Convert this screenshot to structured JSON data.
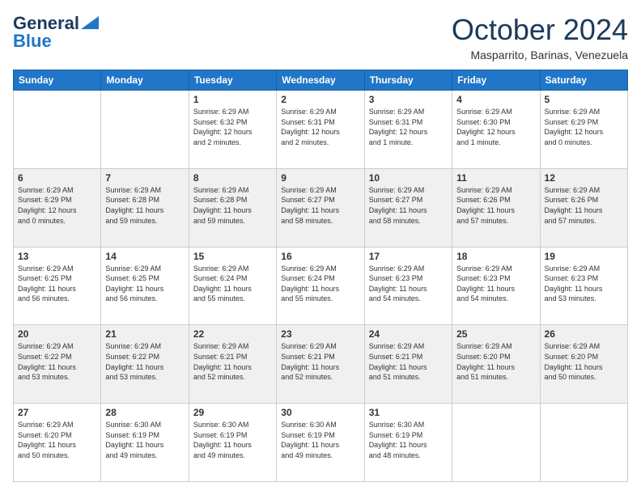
{
  "header": {
    "logo_line1": "General",
    "logo_line2": "Blue",
    "month": "October 2024",
    "location": "Masparrito, Barinas, Venezuela"
  },
  "weekdays": [
    "Sunday",
    "Monday",
    "Tuesday",
    "Wednesday",
    "Thursday",
    "Friday",
    "Saturday"
  ],
  "weeks": [
    [
      {
        "day": "",
        "info": ""
      },
      {
        "day": "",
        "info": ""
      },
      {
        "day": "1",
        "info": "Sunrise: 6:29 AM\nSunset: 6:32 PM\nDaylight: 12 hours\nand 2 minutes."
      },
      {
        "day": "2",
        "info": "Sunrise: 6:29 AM\nSunset: 6:31 PM\nDaylight: 12 hours\nand 2 minutes."
      },
      {
        "day": "3",
        "info": "Sunrise: 6:29 AM\nSunset: 6:31 PM\nDaylight: 12 hours\nand 1 minute."
      },
      {
        "day": "4",
        "info": "Sunrise: 6:29 AM\nSunset: 6:30 PM\nDaylight: 12 hours\nand 1 minute."
      },
      {
        "day": "5",
        "info": "Sunrise: 6:29 AM\nSunset: 6:29 PM\nDaylight: 12 hours\nand 0 minutes."
      }
    ],
    [
      {
        "day": "6",
        "info": "Sunrise: 6:29 AM\nSunset: 6:29 PM\nDaylight: 12 hours\nand 0 minutes."
      },
      {
        "day": "7",
        "info": "Sunrise: 6:29 AM\nSunset: 6:28 PM\nDaylight: 11 hours\nand 59 minutes."
      },
      {
        "day": "8",
        "info": "Sunrise: 6:29 AM\nSunset: 6:28 PM\nDaylight: 11 hours\nand 59 minutes."
      },
      {
        "day": "9",
        "info": "Sunrise: 6:29 AM\nSunset: 6:27 PM\nDaylight: 11 hours\nand 58 minutes."
      },
      {
        "day": "10",
        "info": "Sunrise: 6:29 AM\nSunset: 6:27 PM\nDaylight: 11 hours\nand 58 minutes."
      },
      {
        "day": "11",
        "info": "Sunrise: 6:29 AM\nSunset: 6:26 PM\nDaylight: 11 hours\nand 57 minutes."
      },
      {
        "day": "12",
        "info": "Sunrise: 6:29 AM\nSunset: 6:26 PM\nDaylight: 11 hours\nand 57 minutes."
      }
    ],
    [
      {
        "day": "13",
        "info": "Sunrise: 6:29 AM\nSunset: 6:25 PM\nDaylight: 11 hours\nand 56 minutes."
      },
      {
        "day": "14",
        "info": "Sunrise: 6:29 AM\nSunset: 6:25 PM\nDaylight: 11 hours\nand 56 minutes."
      },
      {
        "day": "15",
        "info": "Sunrise: 6:29 AM\nSunset: 6:24 PM\nDaylight: 11 hours\nand 55 minutes."
      },
      {
        "day": "16",
        "info": "Sunrise: 6:29 AM\nSunset: 6:24 PM\nDaylight: 11 hours\nand 55 minutes."
      },
      {
        "day": "17",
        "info": "Sunrise: 6:29 AM\nSunset: 6:23 PM\nDaylight: 11 hours\nand 54 minutes."
      },
      {
        "day": "18",
        "info": "Sunrise: 6:29 AM\nSunset: 6:23 PM\nDaylight: 11 hours\nand 54 minutes."
      },
      {
        "day": "19",
        "info": "Sunrise: 6:29 AM\nSunset: 6:23 PM\nDaylight: 11 hours\nand 53 minutes."
      }
    ],
    [
      {
        "day": "20",
        "info": "Sunrise: 6:29 AM\nSunset: 6:22 PM\nDaylight: 11 hours\nand 53 minutes."
      },
      {
        "day": "21",
        "info": "Sunrise: 6:29 AM\nSunset: 6:22 PM\nDaylight: 11 hours\nand 53 minutes."
      },
      {
        "day": "22",
        "info": "Sunrise: 6:29 AM\nSunset: 6:21 PM\nDaylight: 11 hours\nand 52 minutes."
      },
      {
        "day": "23",
        "info": "Sunrise: 6:29 AM\nSunset: 6:21 PM\nDaylight: 11 hours\nand 52 minutes."
      },
      {
        "day": "24",
        "info": "Sunrise: 6:29 AM\nSunset: 6:21 PM\nDaylight: 11 hours\nand 51 minutes."
      },
      {
        "day": "25",
        "info": "Sunrise: 6:29 AM\nSunset: 6:20 PM\nDaylight: 11 hours\nand 51 minutes."
      },
      {
        "day": "26",
        "info": "Sunrise: 6:29 AM\nSunset: 6:20 PM\nDaylight: 11 hours\nand 50 minutes."
      }
    ],
    [
      {
        "day": "27",
        "info": "Sunrise: 6:29 AM\nSunset: 6:20 PM\nDaylight: 11 hours\nand 50 minutes."
      },
      {
        "day": "28",
        "info": "Sunrise: 6:30 AM\nSunset: 6:19 PM\nDaylight: 11 hours\nand 49 minutes."
      },
      {
        "day": "29",
        "info": "Sunrise: 6:30 AM\nSunset: 6:19 PM\nDaylight: 11 hours\nand 49 minutes."
      },
      {
        "day": "30",
        "info": "Sunrise: 6:30 AM\nSunset: 6:19 PM\nDaylight: 11 hours\nand 49 minutes."
      },
      {
        "day": "31",
        "info": "Sunrise: 6:30 AM\nSunset: 6:19 PM\nDaylight: 11 hours\nand 48 minutes."
      },
      {
        "day": "",
        "info": ""
      },
      {
        "day": "",
        "info": ""
      }
    ]
  ]
}
